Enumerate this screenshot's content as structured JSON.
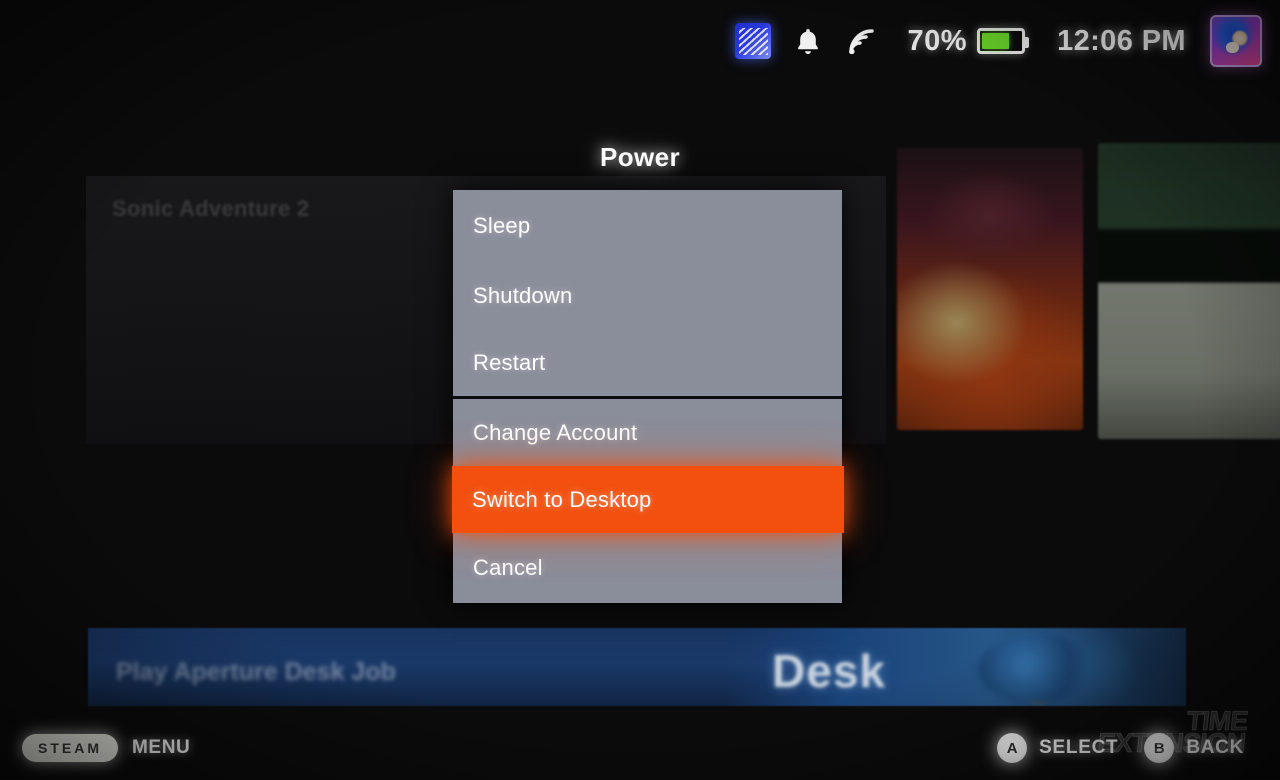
{
  "status_bar": {
    "notification_icon": "steam-notification-badge-icon",
    "bell_icon": "bell-icon",
    "wifi_icon": "wifi-icon",
    "battery_percent_label": "70%",
    "battery_level": 70,
    "battery_icon": "battery-icon",
    "clock": "12:06 PM",
    "avatar": "user-avatar-sonic"
  },
  "background": {
    "panel_title": "Sonic Adventure 2",
    "play_banner_label": "Play Aperture Desk Job",
    "banner_art_text": "Desk",
    "capsule_left": "game-capsule-art-red",
    "capsule_right": "game-capsule-art-green"
  },
  "power_dialog": {
    "title": "Power",
    "groups": [
      {
        "items": [
          {
            "label": "Sleep",
            "selected": false
          },
          {
            "label": "Shutdown",
            "selected": false
          },
          {
            "label": "Restart",
            "selected": false
          }
        ]
      },
      {
        "items": [
          {
            "label": "Change Account",
            "selected": false
          },
          {
            "label": "Switch to Desktop",
            "selected": true
          },
          {
            "label": "Cancel",
            "selected": false
          }
        ]
      }
    ],
    "selected_label": "Switch to Desktop",
    "panel_color": "#8b8e9b",
    "highlight_color": "#f4500f",
    "divider_color": "#0c0c10"
  },
  "bottom_bar": {
    "steam_button_label": "STEAM",
    "menu_label": "MENU",
    "a_button_glyph": "A",
    "a_button_label": "SELECT",
    "b_button_glyph": "B",
    "b_button_label": "BACK"
  },
  "watermark": {
    "line1": "TIME",
    "line2": "EXTENSION"
  },
  "colors": {
    "highlight_orange": "#f4500f",
    "panel_grey": "#8b8e9b",
    "battery_green": "#6ddb2a",
    "banner_blue": "#1d3f74",
    "screen_black": "#0a0a0a"
  }
}
